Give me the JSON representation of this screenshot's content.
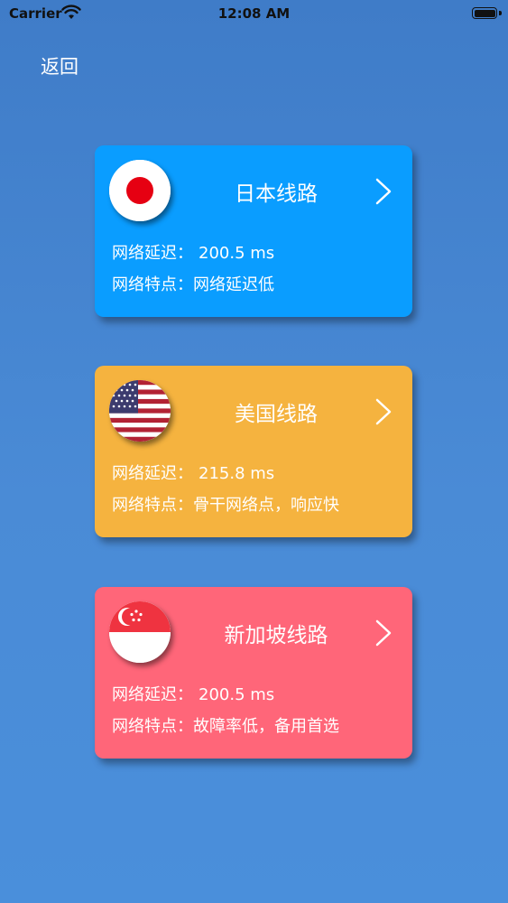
{
  "status_bar": {
    "carrier": "Carrier",
    "time": "12:08 AM"
  },
  "nav": {
    "back_label": "返回"
  },
  "lines": [
    {
      "title": "日本线路",
      "latency_label": "网络延迟：",
      "latency_value": "200.5 ms",
      "feature_label": "网络特点：",
      "feature_value": "网络延迟低",
      "color": "#0a9dff",
      "icon": "japan-flag-icon"
    },
    {
      "title": "美国线路",
      "latency_label": "网络延迟：",
      "latency_value": "215.8 ms",
      "feature_label": "网络特点：",
      "feature_value": "骨干网络点，响应快",
      "color": "#f5b33f",
      "icon": "usa-flag-icon"
    },
    {
      "title": "新加坡线路",
      "latency_label": "网络延迟：",
      "latency_value": "200.5 ms",
      "feature_label": "网络特点：",
      "feature_value": "故障率低，备用首选",
      "color": "#ff6679",
      "icon": "singapore-flag-icon"
    }
  ]
}
